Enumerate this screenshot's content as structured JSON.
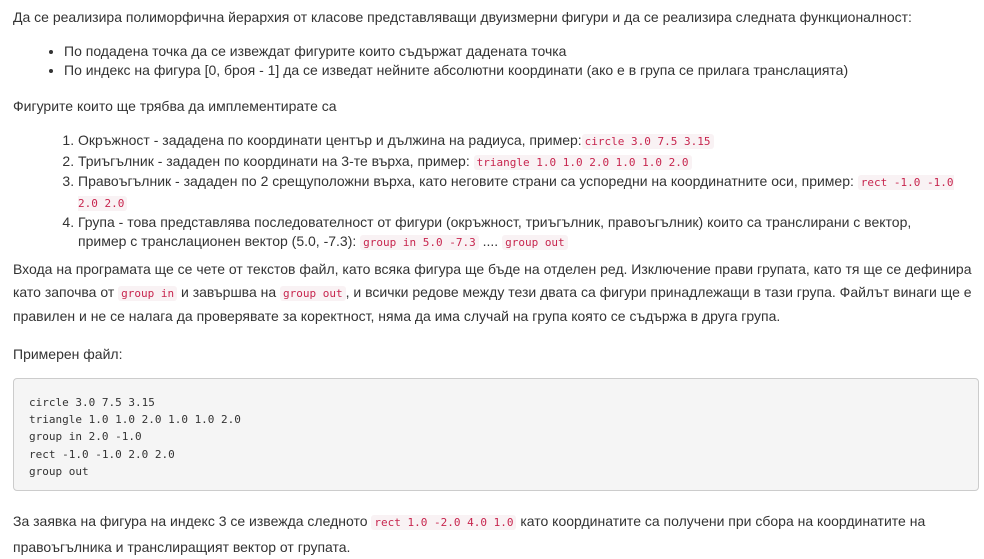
{
  "intro": "Да се реализира полиморфична йерархия от класове представляващи двуизмерни фигури и да се реализира следната функционалност:",
  "bullets": [
    "По подадена точка да се извеждат фигурите които съдържат дадената точка",
    "По индекс на фигура [0, броя - 1] да се изведат нейните абсолютни координати (ако е в група се прилага транслацията)"
  ],
  "shapes_heading": "Фигурите които ще трябва да имплементирате са",
  "shapes": [
    {
      "text": "Окръжност - зададена по координати център и дължина на радиуса, пример:",
      "code": "circle 3.0 7.5 3.15"
    },
    {
      "text": "Триъгълник - зададен по координати на 3-те върха, пример: ",
      "code": "triangle 1.0 1.0 2.0 1.0 1.0 2.0"
    },
    {
      "text": "Правоъгълник - зададен по 2 срещуположни върха, като неговите страни са успоредни на координатните оси, пример: ",
      "code": "rect -1.0 -1.0 2.0 2.0"
    },
    {
      "text": "Група - това представлява последователност от фигури (окръжност, триъгълник, правоъгълник) които са транслирани с вектор, пример с транслационен вектор (5.0, -7.3): ",
      "code": "group in 5.0 -7.3",
      "middle": " .... ",
      "code2": "group out"
    }
  ],
  "input_desc": {
    "part1": "Входа на програмата ще се чете от текстов файл, като всяка фигура ще бъде на отделен ред. Изключение прави групата, като тя ще се дефинира като започва от ",
    "code1": "group in",
    "part2": " и завършва на ",
    "code2": "group out",
    "part3": ", и всички редове между тези двата са фигури принадлежащи в тази група. Файлът винаги ще е правилен и не се налага да проверявате за коректност, няма да има случай на група която се съдържа в друга група."
  },
  "example_heading": "Примерен файл:",
  "sample_lines": [
    "circle 3.0 7.5 3.15",
    "triangle 1.0 1.0 2.0 1.0 1.0 2.0",
    "group in 2.0 -1.0",
    "rect -1.0 -1.0 2.0 2.0",
    "group out"
  ],
  "query_desc": {
    "part1": "За заявка на фигура на индекс 3 се извежда следното ",
    "code": "rect 1.0 -2.0 4.0 1.0",
    "part2": " като координатите са получени при сбора на координатите на правоъгълника и транслиращият вектор от групата."
  }
}
